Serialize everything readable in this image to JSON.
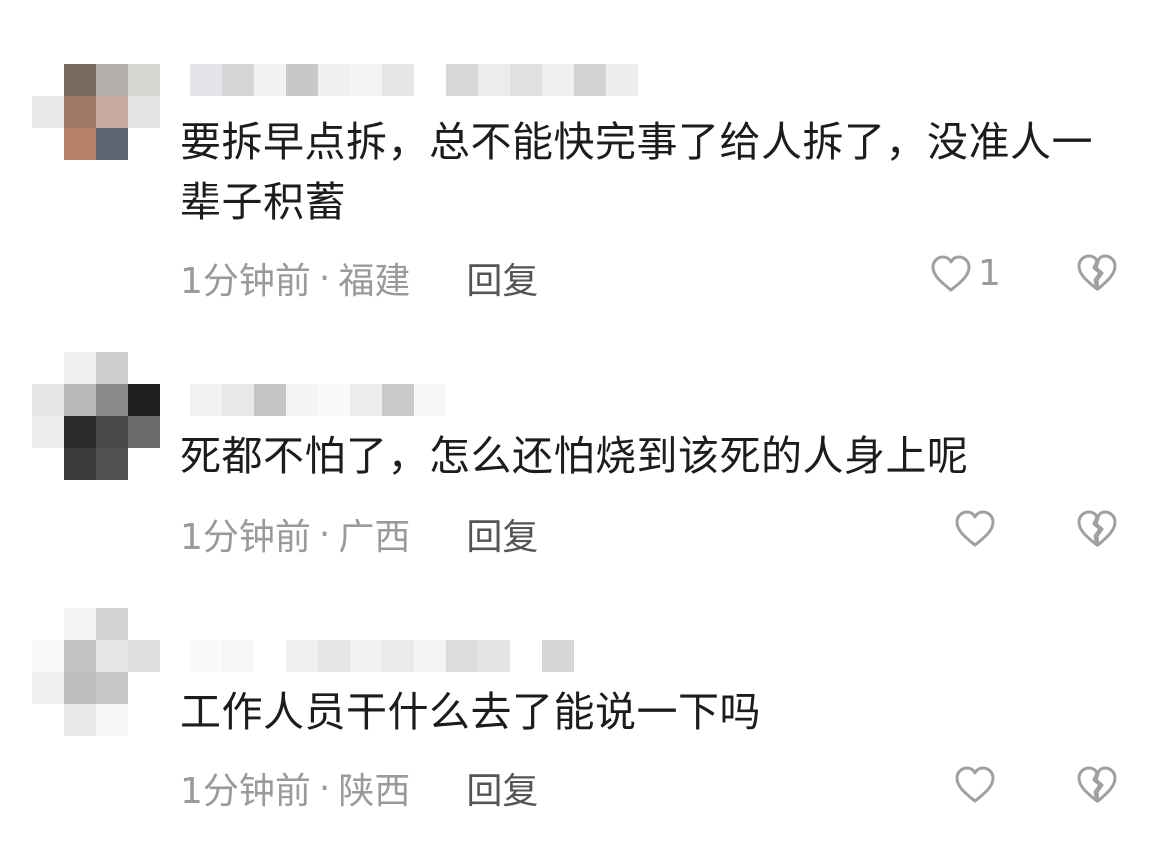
{
  "comments": [
    {
      "text": "要拆早点拆，总不能快完事了给人拆了，没准人一辈子积蓄",
      "time": "1分钟前",
      "separator": "·",
      "location": "福建",
      "reply_label": "回复",
      "likes": "1",
      "like_icon": "heart-outline-icon",
      "dislike_icon": "broken-heart-icon"
    },
    {
      "text": "死都不怕了，怎么还怕烧到该死的人身上呢",
      "time": "1分钟前",
      "separator": "·",
      "location": "广西",
      "reply_label": "回复",
      "likes": "",
      "like_icon": "heart-outline-icon",
      "dislike_icon": "broken-heart-icon"
    },
    {
      "text": "工作人员干什么去了能说一下吗",
      "time": "1分钟前",
      "separator": "·",
      "location": "陕西",
      "reply_label": "回复",
      "likes": "",
      "like_icon": "heart-outline-icon",
      "dislike_icon": "broken-heart-icon"
    }
  ],
  "colors": {
    "text": "#1c1c1c",
    "meta": "#9a9a9a",
    "reply": "#555555",
    "icon": "#a0a0a0"
  }
}
